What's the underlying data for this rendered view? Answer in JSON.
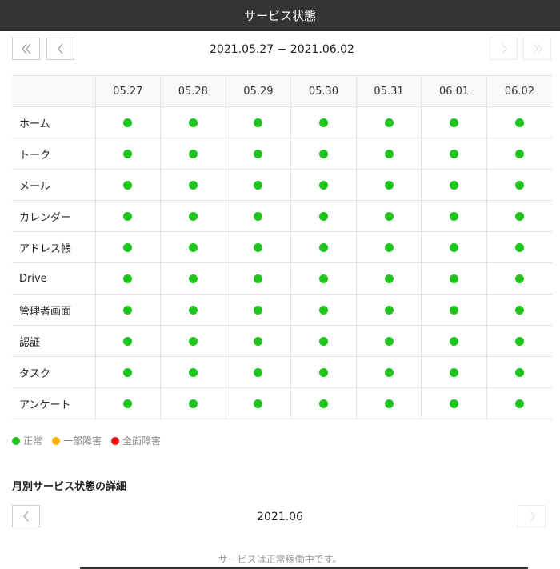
{
  "header": {
    "title": "サービス状態"
  },
  "week": {
    "range": "2021.05.27 − 2021.06.02"
  },
  "table": {
    "dates": [
      "05.27",
      "05.28",
      "05.29",
      "05.30",
      "05.31",
      "06.01",
      "06.02"
    ],
    "services": [
      {
        "name": "ホーム",
        "statuses": [
          "normal",
          "normal",
          "normal",
          "normal",
          "normal",
          "normal",
          "normal"
        ]
      },
      {
        "name": "トーク",
        "statuses": [
          "normal",
          "normal",
          "normal",
          "normal",
          "normal",
          "normal",
          "normal"
        ]
      },
      {
        "name": "メール",
        "statuses": [
          "normal",
          "normal",
          "normal",
          "normal",
          "normal",
          "normal",
          "normal"
        ]
      },
      {
        "name": "カレンダー",
        "statuses": [
          "normal",
          "normal",
          "normal",
          "normal",
          "normal",
          "normal",
          "normal"
        ]
      },
      {
        "name": "アドレス帳",
        "statuses": [
          "normal",
          "normal",
          "normal",
          "normal",
          "normal",
          "normal",
          "normal"
        ]
      },
      {
        "name": "Drive",
        "statuses": [
          "normal",
          "normal",
          "normal",
          "normal",
          "normal",
          "normal",
          "normal"
        ]
      },
      {
        "name": "管理者画面",
        "statuses": [
          "normal",
          "normal",
          "normal",
          "normal",
          "normal",
          "normal",
          "normal"
        ]
      },
      {
        "name": "認証",
        "statuses": [
          "normal",
          "normal",
          "normal",
          "normal",
          "normal",
          "normal",
          "normal"
        ]
      },
      {
        "name": "タスク",
        "statuses": [
          "normal",
          "normal",
          "normal",
          "normal",
          "normal",
          "normal",
          "normal"
        ]
      },
      {
        "name": "アンケート",
        "statuses": [
          "normal",
          "normal",
          "normal",
          "normal",
          "normal",
          "normal",
          "normal"
        ]
      }
    ]
  },
  "status_colors": {
    "normal": "#1fc41f",
    "partial": "#ffb100",
    "full": "#ee1111"
  },
  "legend": [
    {
      "key": "normal",
      "label": "正常"
    },
    {
      "key": "partial",
      "label": "一部障害"
    },
    {
      "key": "full",
      "label": "全面障害"
    }
  ],
  "monthly": {
    "title": "月別サービス状態の詳細",
    "month": "2021.06",
    "message": "サービスは正常稼働中です。"
  }
}
